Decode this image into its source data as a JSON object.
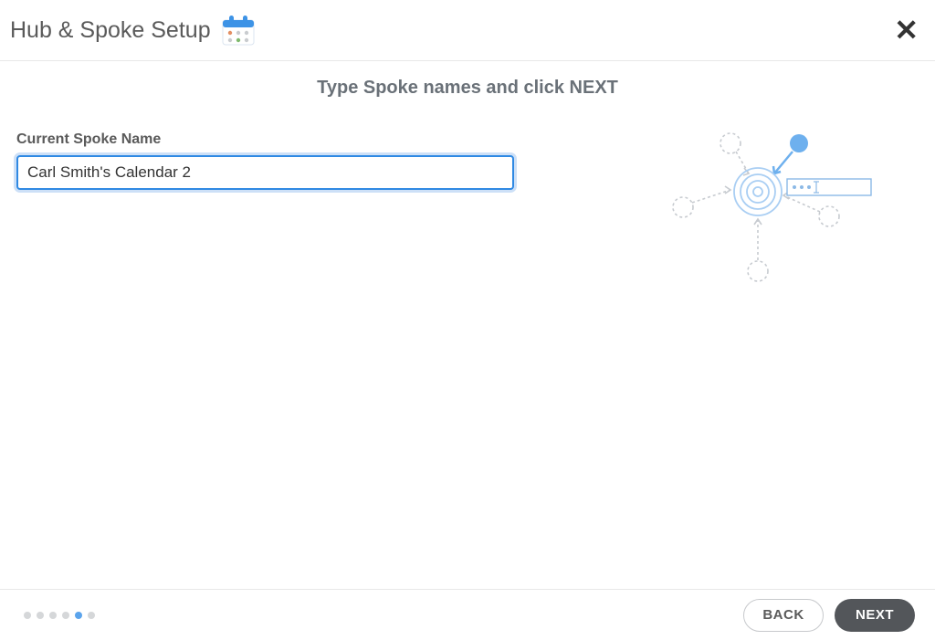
{
  "header": {
    "title": "Hub & Spoke Setup"
  },
  "instruction": "Type Spoke names and click NEXT",
  "form": {
    "current_spoke_label": "Current Spoke Name",
    "current_spoke_value": "Carl Smith's Calendar 2"
  },
  "footer": {
    "back_label": "BACK",
    "next_label": "NEXT"
  },
  "stepper": {
    "total": 6,
    "active_index": 4
  }
}
